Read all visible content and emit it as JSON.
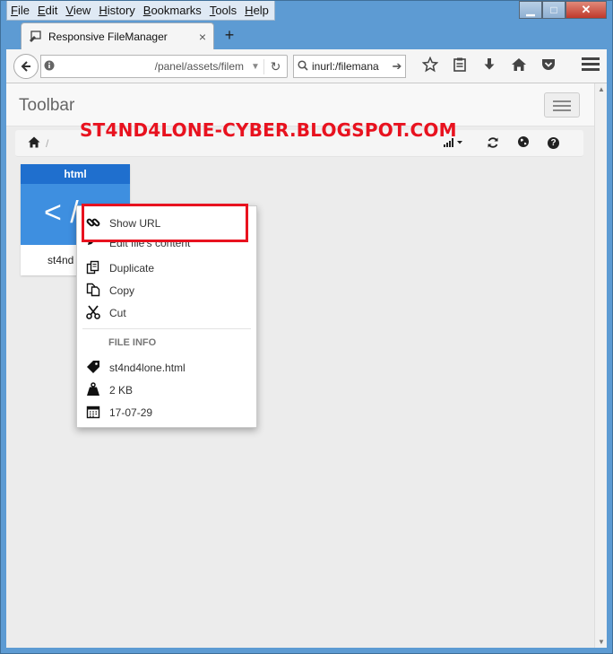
{
  "menubar": {
    "items": [
      "File",
      "Edit",
      "View",
      "History",
      "Bookmarks",
      "Tools",
      "Help"
    ],
    "accel": [
      "F",
      "E",
      "V",
      "H",
      "B",
      "T",
      "H"
    ]
  },
  "window_controls": {
    "minimize": "▁",
    "maximize": "□",
    "close": "✕"
  },
  "tab": {
    "title": "Responsive FileManager",
    "close": "×",
    "new_tab": "+"
  },
  "navbar": {
    "url": "/panel/assets/filem",
    "search_value": "inurl:/filemana",
    "icons": [
      "star-icon",
      "reading-list-icon",
      "download-icon",
      "home-icon",
      "pocket-icon",
      "menu-icon"
    ]
  },
  "page": {
    "toolbar_title": "Toolbar",
    "watermark": "ST4ND4LONE-CYBER.BLOGSPOT.COM",
    "breadcrumb_separator": "/",
    "help_glyph": "?"
  },
  "file": {
    "type": "html",
    "icon_text": "< /",
    "name": "st4nd"
  },
  "context_menu": {
    "items": [
      {
        "label": "Show URL",
        "icon": "link-icon"
      },
      {
        "label": "Edit file's content",
        "icon": "pencil-icon"
      },
      {
        "label": "Duplicate",
        "icon": "duplicate-icon"
      },
      {
        "label": "Copy",
        "icon": "copy-icon"
      },
      {
        "label": "Cut",
        "icon": "scissors-icon"
      }
    ],
    "info_header": "FILE INFO",
    "info": [
      {
        "label": "st4nd4lone.html",
        "icon": "tag-icon"
      },
      {
        "label": "2 KB",
        "icon": "weight-icon"
      },
      {
        "label": "17-07-29",
        "icon": "calendar-icon"
      }
    ]
  },
  "colors": {
    "highlight_border": "#e8121f",
    "watermark": "#e8121f",
    "file_header": "#1f6fce",
    "file_icon_bg": "#3e8fe0"
  }
}
